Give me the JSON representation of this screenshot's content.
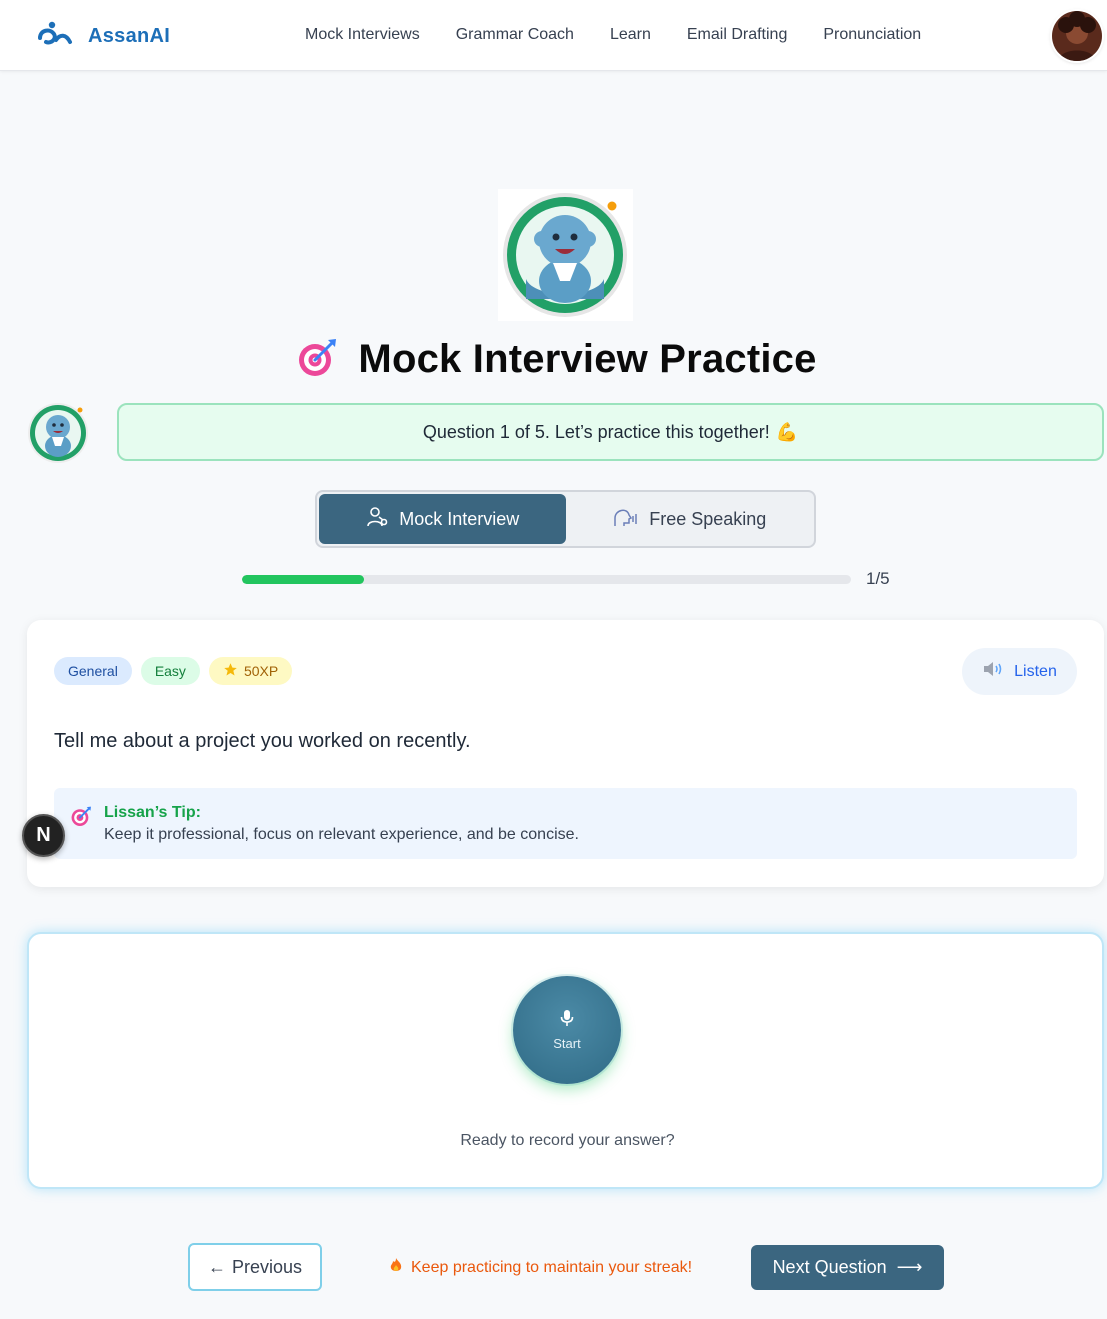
{
  "header": {
    "brand": "AssanAI",
    "nav": [
      "Mock Interviews",
      "Grammar Coach",
      "Learn",
      "Email Drafting",
      "Pronunciation"
    ]
  },
  "hero": {
    "title": "Mock Interview Practice",
    "title_icon": "target-dart-icon"
  },
  "coach": {
    "message": "Question 1 of 5. Let’s practice this together!",
    "emoji": "💪"
  },
  "modes": {
    "mock": "Mock Interview",
    "free": "Free Speaking",
    "active": "mock"
  },
  "progress": {
    "current": 1,
    "total": 5,
    "label": "1/5",
    "fraction": 0.2
  },
  "question": {
    "category": "General",
    "difficulty": "Easy",
    "xp": "50XP",
    "listen_label": "Listen",
    "text": "Tell me about a project you worked on recently."
  },
  "tip": {
    "title": "Lissan’s Tip:",
    "text": "Keep it professional, focus on relevant experience, and be concise."
  },
  "floating_badge": "N",
  "recorder": {
    "button_label": "Start",
    "prompt": "Ready to record your answer?"
  },
  "footer": {
    "previous": "Previous",
    "streak": "Keep practicing to maintain your streak!",
    "next": "Next Question"
  },
  "colors": {
    "brand_blue": "#1d6fb8",
    "primary": "#3b6680",
    "progress_green": "#22c55e",
    "streak_orange": "#ea580c"
  }
}
